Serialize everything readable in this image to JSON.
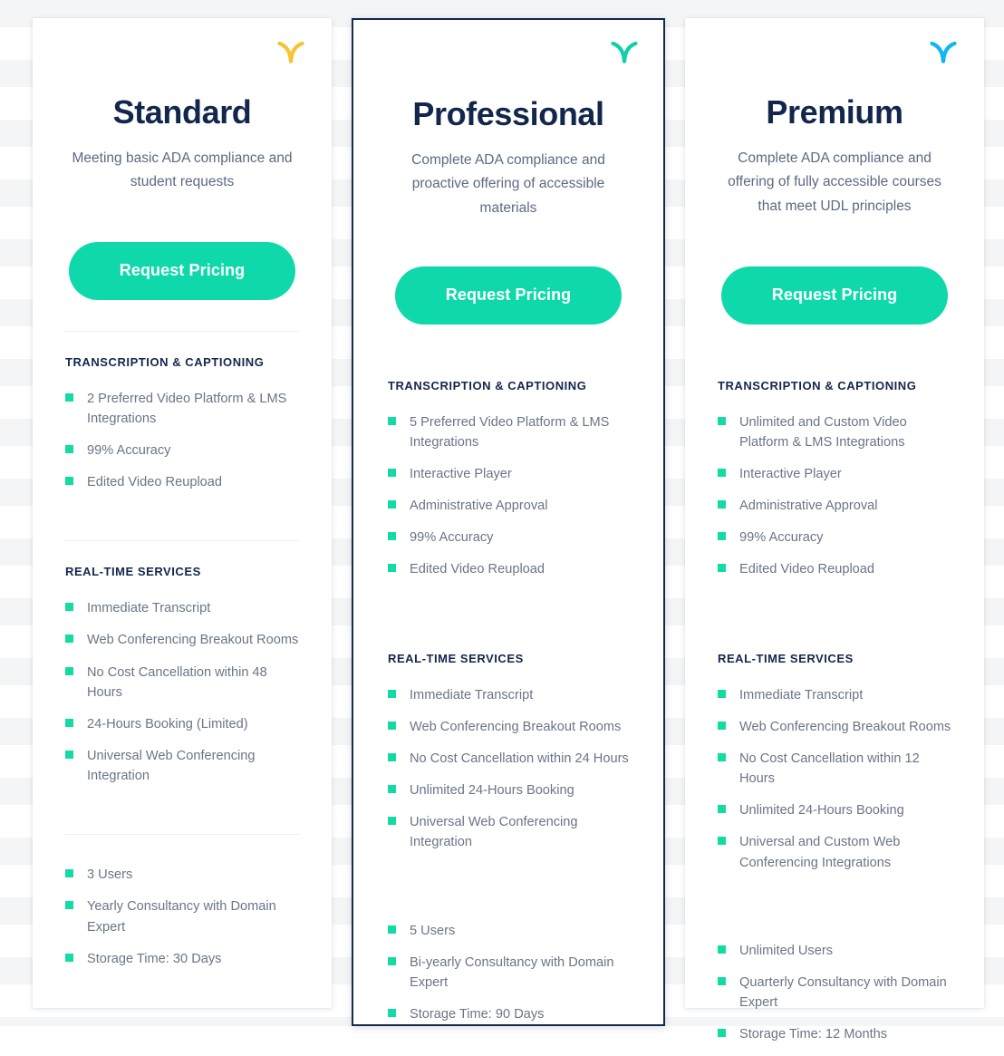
{
  "theme": {
    "accent_teal": "#0fd9ab",
    "bullet_teal": "#13dba4",
    "heading_navy": "#13274c",
    "body_gray": "#6a7586",
    "featured_border": "#132a4d"
  },
  "section_labels": {
    "transcription": "TRANSCRIPTION & CAPTIONING",
    "realtime": "REAL-TIME SERVICES"
  },
  "plans": [
    {
      "name": "Standard",
      "description": "Meeting basic ADA compliance and student requests",
      "cta_label": "Request Pricing",
      "mark_color": "#f5c431",
      "mark_name": "brand-y-mark-gold",
      "featured": false,
      "transcription_features": [
        "2 Preferred Video Platform & LMS Integrations",
        "99% Accuracy",
        "Edited Video Reupload"
      ],
      "realtime_features": [
        "Immediate Transcript",
        "Web Conferencing Breakout Rooms",
        "No Cost Cancellation within 48 Hours",
        "24-Hours Booking (Limited)",
        "Universal Web Conferencing Integration"
      ],
      "account_features": [
        "3 Users",
        "Yearly Consultancy with Domain Expert",
        "Storage Time: 30 Days"
      ]
    },
    {
      "name": "Professional",
      "description": "Complete ADA compliance and proactive offering of accessible materials",
      "cta_label": "Request Pricing",
      "mark_color": "#0fd0a8",
      "mark_name": "brand-y-mark-teal",
      "featured": true,
      "transcription_features": [
        "5 Preferred Video Platform & LMS Integrations",
        "Interactive Player",
        "Administrative Approval",
        "99% Accuracy",
        "Edited Video Reupload"
      ],
      "realtime_features": [
        "Immediate Transcript",
        "Web Conferencing Breakout Rooms",
        "No Cost Cancellation within 24 Hours",
        "Unlimited 24-Hours Booking",
        "Universal Web Conferencing Integration"
      ],
      "account_features": [
        "5 Users",
        "Bi-yearly Consultancy with Domain Expert",
        "Storage Time: 90 Days"
      ]
    },
    {
      "name": "Premium",
      "description": "Complete ADA compliance and offering of fully accessible courses that meet UDL principles",
      "cta_label": "Request Pricing",
      "mark_color": "#0cb7f2",
      "mark_name": "brand-y-mark-blue",
      "featured": false,
      "transcription_features": [
        "Unlimited and Custom Video Platform & LMS Integrations",
        "Interactive Player",
        "Administrative Approval",
        "99% Accuracy",
        "Edited Video Reupload"
      ],
      "realtime_features": [
        "Immediate Transcript",
        "Web Conferencing Breakout Rooms",
        "No Cost Cancellation within 12 Hours",
        "Unlimited 24-Hours Booking",
        "Universal and Custom Web Conferencing Integrations"
      ],
      "account_features": [
        "Unlimited Users",
        "Quarterly Consultancy with Domain Expert",
        "Storage Time: 12 Months"
      ]
    }
  ]
}
